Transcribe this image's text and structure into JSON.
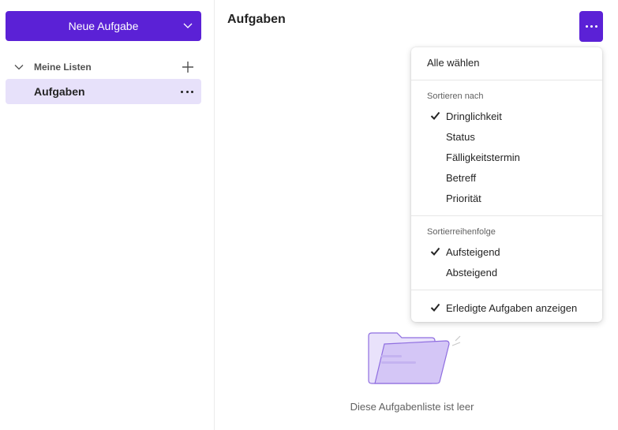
{
  "sidebar": {
    "new_task_label": "Neue Aufgabe",
    "lists_header": "Meine Listen",
    "lists": [
      {
        "label": "Aufgaben",
        "selected": true
      }
    ]
  },
  "main": {
    "title": "Aufgaben",
    "empty_message": "Diese Aufgabenliste ist leer"
  },
  "menu": {
    "select_all": "Alle wählen",
    "sort_by_header": "Sortieren nach",
    "sort_options": [
      {
        "label": "Dringlichkeit",
        "checked": true
      },
      {
        "label": "Status",
        "checked": false
      },
      {
        "label": "Fälligkeitstermin",
        "checked": false
      },
      {
        "label": "Betreff",
        "checked": false
      },
      {
        "label": "Priorität",
        "checked": false
      }
    ],
    "order_header": "Sortierreihenfolge",
    "order_options": [
      {
        "label": "Aufsteigend",
        "checked": true
      },
      {
        "label": "Absteigend",
        "checked": false
      }
    ],
    "show_completed": {
      "label": "Erledigte Aufgaben anzeigen",
      "checked": true
    }
  },
  "colors": {
    "accent": "#5b21d6",
    "selected_bg": "#e7e1fa"
  },
  "icons": {
    "new_task_dropdown": "chevron-down-icon",
    "collapse": "chevron-down-icon",
    "add_list": "plus-icon",
    "list_more": "more-horizontal-icon",
    "header_more": "more-horizontal-icon",
    "check": "checkmark-icon",
    "empty": "folder-illustration-icon"
  }
}
